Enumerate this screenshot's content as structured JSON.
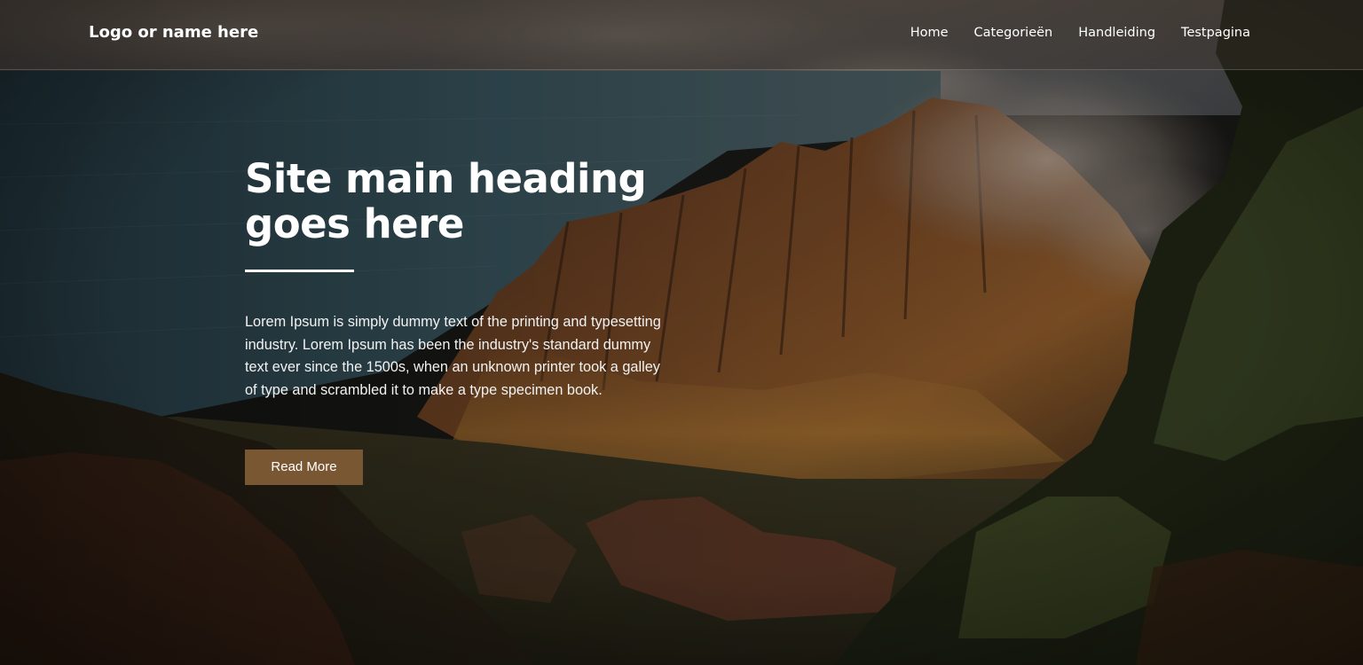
{
  "header": {
    "logo_text": "Logo or name here",
    "nav_items": [
      {
        "label": "Home"
      },
      {
        "label": "Categorieën"
      },
      {
        "label": "Handleiding"
      },
      {
        "label": "Testpagina"
      }
    ]
  },
  "hero": {
    "heading": "Site main heading goes here",
    "intro": "Lorem Ipsum is simply dummy text of the printing and typesetting industry. Lorem Ipsum has been the industry's standard dummy text ever since the 1500s, when an unknown printer took a galley of type and scrambled it to make a type specimen book.",
    "button_label": "Read More",
    "background_image": "mountain-valley-coast-landscape"
  },
  "colors": {
    "button_bg": "#7a5733",
    "text": "#ffffff",
    "header_overlay": "#3c322c"
  }
}
